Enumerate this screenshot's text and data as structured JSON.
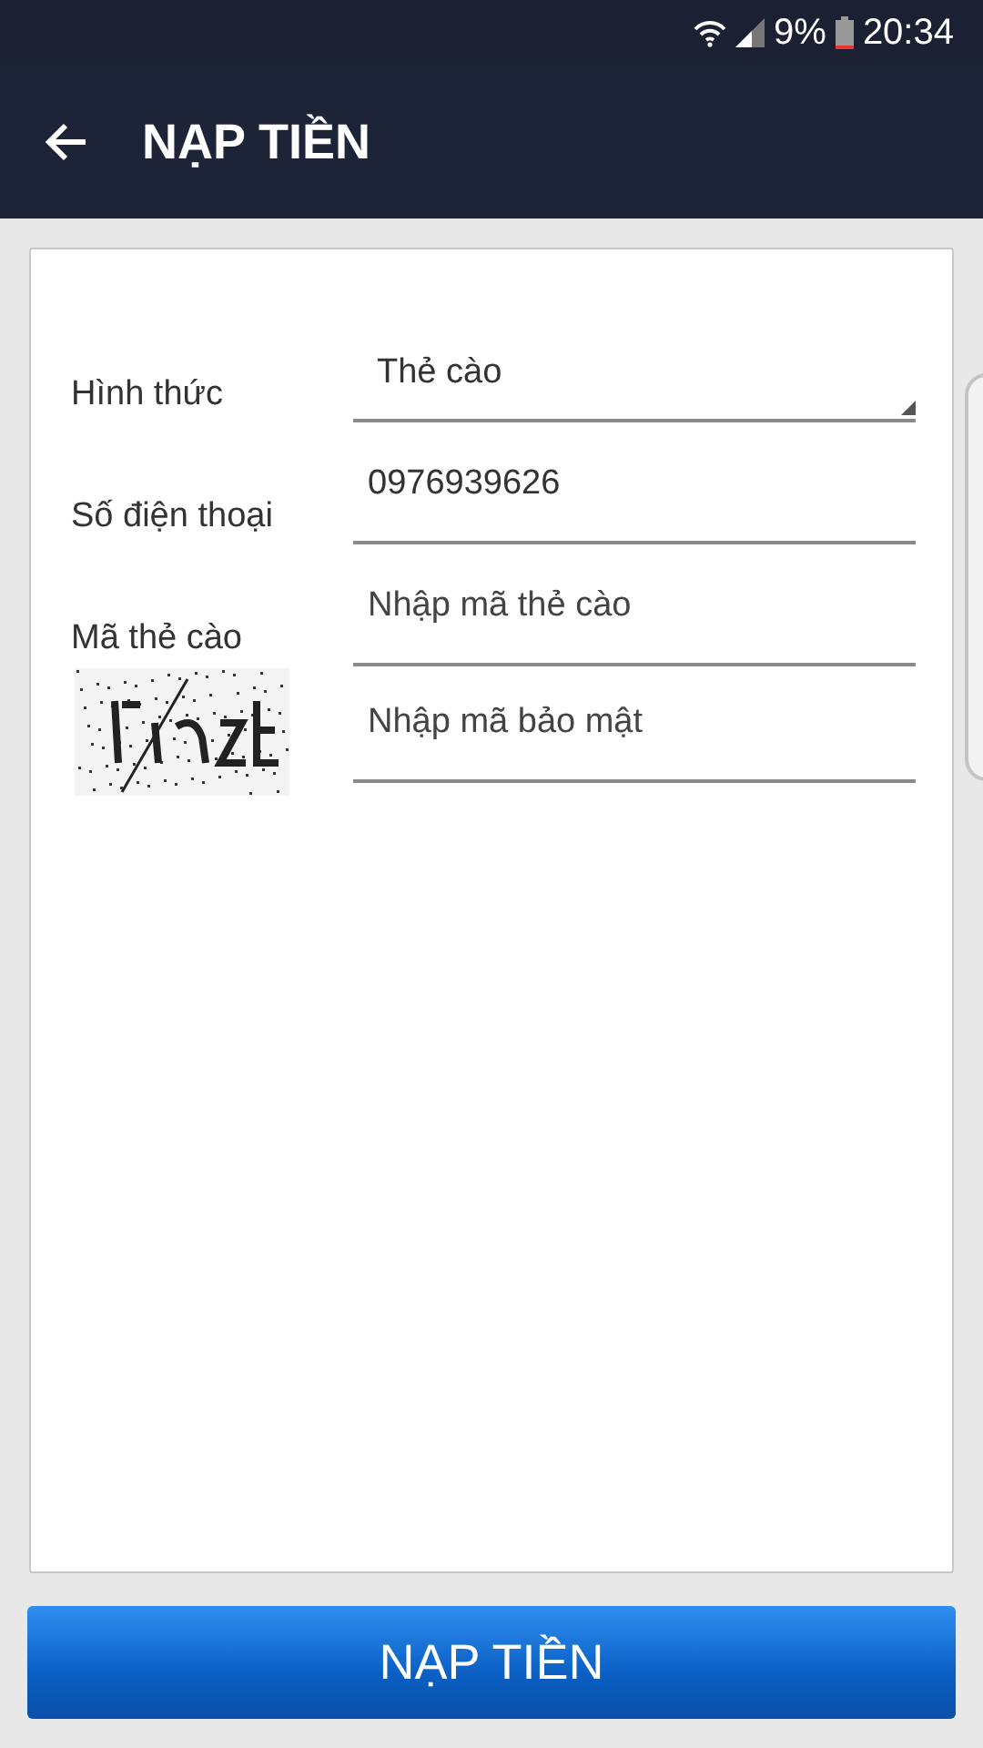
{
  "status_bar": {
    "battery": "9%",
    "time": "20:34"
  },
  "app_bar": {
    "title": "NẠP TIỀN"
  },
  "form": {
    "rows": [
      {
        "kind": "select",
        "label": "Hình thức",
        "value": "Thẻ cào"
      },
      {
        "kind": "input",
        "label": "Số điện thoại",
        "value": "0976939626"
      },
      {
        "kind": "input",
        "label": "Mã thẻ cào",
        "placeholder": "Nhập mã thẻ cào"
      },
      {
        "kind": "captcha",
        "placeholder": "Nhập mã bảo mật"
      }
    ]
  },
  "submit_button": "NẠP TIỀN"
}
